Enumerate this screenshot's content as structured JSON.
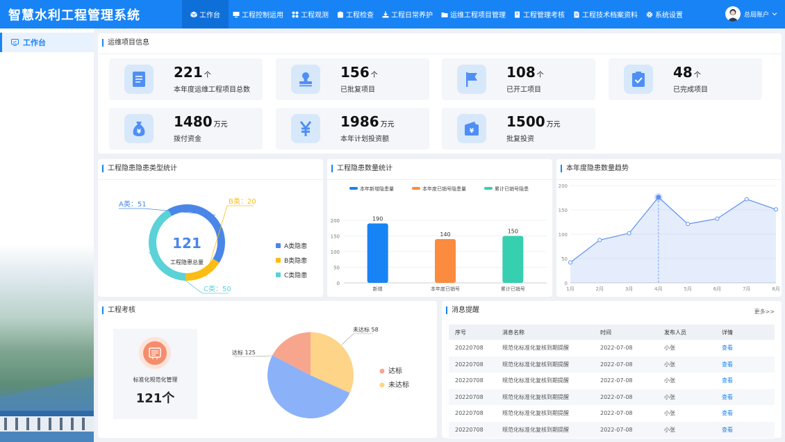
{
  "app": {
    "title": "智慧水利工程管理系统"
  },
  "nav": [
    {
      "label": "工作台",
      "icon": "cube-icon",
      "active": true
    },
    {
      "label": "工程控制运用",
      "icon": "monitor-icon"
    },
    {
      "label": "工程观测",
      "icon": "grid-icon"
    },
    {
      "label": "工程检查",
      "icon": "clipboard-icon"
    },
    {
      "label": "工程日常养护",
      "icon": "download-tray-icon"
    },
    {
      "label": "运维工程项目管理",
      "icon": "folder-icon"
    },
    {
      "label": "工程管理考核",
      "icon": "edit-doc-icon"
    },
    {
      "label": "工程技术档案资料",
      "icon": "document-icon"
    },
    {
      "label": "系统设置",
      "icon": "gear-icon"
    }
  ],
  "user": {
    "name": "总局账户"
  },
  "sidebar": {
    "items": [
      {
        "label": "工作台"
      }
    ]
  },
  "project_info": {
    "title": "运维项目信息",
    "cards": [
      {
        "value": "221",
        "unit": "个",
        "label": "本年度运维工程项目总数",
        "icon": "document-list-icon"
      },
      {
        "value": "156",
        "unit": "个",
        "label": "已批复项目",
        "icon": "stamp-icon"
      },
      {
        "value": "108",
        "unit": "个",
        "label": "已开工项目",
        "icon": "flag-icon"
      },
      {
        "value": "48",
        "unit": "个",
        "label": "已完成项目",
        "icon": "checklist-icon"
      },
      {
        "value": "1480",
        "unit": "万元",
        "label": "拨付资金",
        "icon": "money-bag-icon"
      },
      {
        "value": "1986",
        "unit": "万元",
        "label": "本年计划投资额",
        "icon": "yuan-icon"
      },
      {
        "value": "1500",
        "unit": "万元",
        "label": "批复投资",
        "icon": "wallet-icon"
      }
    ]
  },
  "hazard_type": {
    "title": "工程隐患隐患类型统计",
    "total_value": "121",
    "total_label": "工程隐患总量",
    "chart_data": {
      "type": "pie",
      "categories": [
        "A类隐患",
        "B类隐患",
        "C类隐患"
      ],
      "values": [
        51,
        20,
        50
      ],
      "data_labels": [
        "A类：51",
        "B类：20",
        "C类：50"
      ],
      "colors": [
        "#4a86e8",
        "#fbbd13",
        "#5ad2d7"
      ],
      "legend": "right"
    }
  },
  "hazard_count": {
    "title": "工程隐患数量统计",
    "chart_data": {
      "type": "bar",
      "categories": [
        "新增",
        "本年度已销号",
        "累计已销号"
      ],
      "values": [
        190,
        140,
        150
      ],
      "legend_labels": [
        "本年新增隐患量",
        "本年度已销号隐患量",
        "累计已销号隐患"
      ],
      "colors": [
        "#1883f5",
        "#fb8b3f",
        "#36cfb0"
      ],
      "yticks": [
        "0",
        "50",
        "100",
        "150",
        "200"
      ],
      "ylim": [
        0,
        200
      ],
      "legend": "top"
    }
  },
  "hazard_trend": {
    "title": "本年度隐患数量趋势",
    "chart_data": {
      "type": "area",
      "x": [
        "1月",
        "2月",
        "3月",
        "4月",
        "5月",
        "6月",
        "7月",
        "8月"
      ],
      "values": [
        42,
        88,
        102,
        176,
        121,
        132,
        172,
        151
      ],
      "yticks": [
        "0",
        "50",
        "100",
        "150",
        "200"
      ],
      "ylim": [
        0,
        200
      ],
      "highlight_index": 3,
      "color": "#5b8ff0"
    }
  },
  "exam": {
    "title": "工程考核",
    "box_label": "标准化规范化管理",
    "box_value": "121个",
    "chart_data": {
      "type": "pie",
      "categories": [
        "达标",
        "未达标"
      ],
      "values": [
        125,
        58
      ],
      "data_labels": [
        "达标  125",
        "未达标  58"
      ],
      "colors": [
        "#f7a58d",
        "#fdd488",
        "#8bb1f8"
      ],
      "legend": "right"
    }
  },
  "messages": {
    "title": "消息提醒",
    "more": "更多>>",
    "columns": [
      "序号",
      "消息名称",
      "时间",
      "发布人员",
      "详情"
    ],
    "rows": [
      [
        "20220708",
        "规范化标准化复核到期提醒",
        "2022-07-08",
        "小张",
        "查看"
      ],
      [
        "20220708",
        "规范化标准化复核到期提醒",
        "2022-07-08",
        "小张",
        "查看"
      ],
      [
        "20220708",
        "规范化标准化复核到期提醒",
        "2022-07-08",
        "小张",
        "查看"
      ],
      [
        "20220708",
        "规范化标准化复核到期提醒",
        "2022-07-08",
        "小张",
        "查看"
      ],
      [
        "20220708",
        "规范化标准化复核到期提醒",
        "2022-07-08",
        "小张",
        "查看"
      ],
      [
        "20220708",
        "规范化标准化复核到期提醒",
        "2022-07-08",
        "小张",
        "查看"
      ]
    ]
  }
}
